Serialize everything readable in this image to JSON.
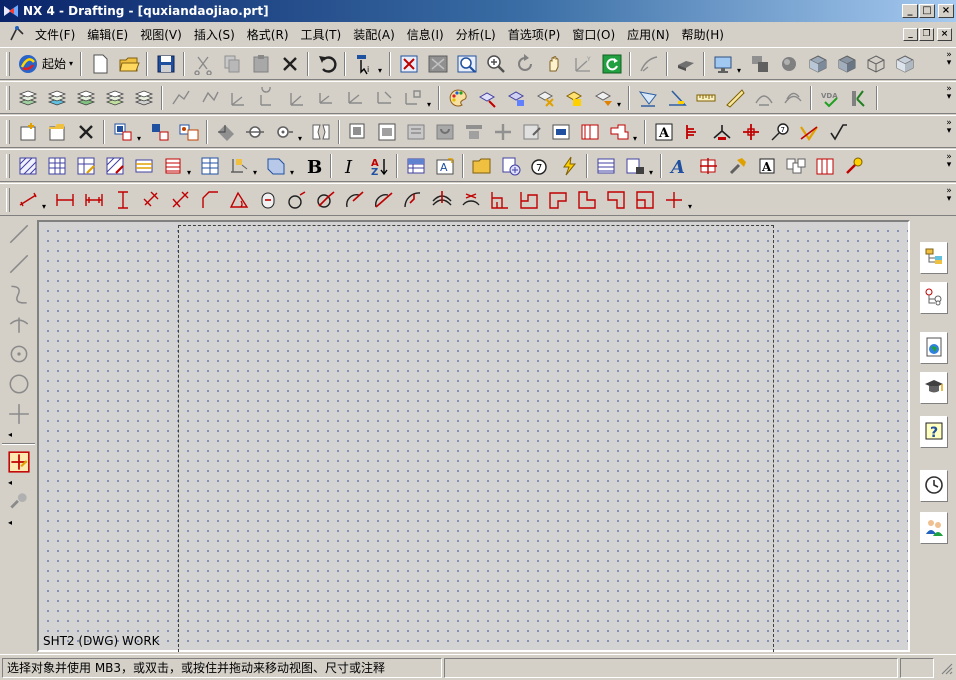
{
  "window": {
    "title": "NX 4 - Drafting - [quxiandaojiao.prt]",
    "minimize": "_",
    "maximize": "□",
    "close": "×"
  },
  "menu": {
    "items": [
      {
        "label": "文件(F)"
      },
      {
        "label": "编辑(E)"
      },
      {
        "label": "视图(V)"
      },
      {
        "label": "插入(S)"
      },
      {
        "label": "格式(R)"
      },
      {
        "label": "工具(T)"
      },
      {
        "label": "装配(A)"
      },
      {
        "label": "信息(I)"
      },
      {
        "label": "分析(L)"
      },
      {
        "label": "首选项(P)"
      },
      {
        "label": "窗口(O)"
      },
      {
        "label": "应用(N)"
      },
      {
        "label": "帮助(H)"
      }
    ],
    "mdi_minimize": "_",
    "mdi_restore": "❐",
    "mdi_close": "×"
  },
  "toolbar": {
    "start_label": "起始",
    "dropdown_glyph": "▾",
    "overflow_glyph": "»"
  },
  "canvas": {
    "view_label": "SHT2 (DWG) WORK"
  },
  "statusbar": {
    "message": "选择对象并使用 MB3，或双击，或按住并拖动来移动视图、尺寸或注释",
    "cell2": "",
    "cell3": ""
  },
  "colors": {
    "title_active": "#0a246a",
    "canvas_bg": "#d3d3d3",
    "grid_dot": "#6f7fb0",
    "chrome": "#d4d0c8"
  },
  "icons": {
    "row1": [
      "start-icon",
      "new-icon",
      "open-icon",
      "save-icon",
      "cut-icon",
      "copy-icon",
      "paste-icon",
      "delete-icon",
      "undo-icon",
      "select-icon",
      "fit-icon",
      "zoom-window-icon",
      "zoom-area-icon",
      "zoom-icon",
      "rotate-icon",
      "pan-icon",
      "wcs-icon",
      "refresh-icon",
      "sweep-icon",
      "view-shaded-icon",
      "display-icon",
      "layout-icon",
      "sphere-icon",
      "cube-shaded-icon",
      "cube-flat-icon",
      "cube-wire-icon",
      "cube-hidden-icon"
    ],
    "row2": [
      "layer-icon",
      "layer-settings-icon",
      "layer-move-icon",
      "layer-copy-icon",
      "layer-visible-icon",
      "spline-icon",
      "point-set-icon",
      "datum-axis-icon",
      "datum-plane-icon",
      "wcs-origin-icon",
      "wcs-point-icon",
      "wcs-xc-icon",
      "wcs-yc-icon",
      "wcs-orient-icon",
      "palette-icon",
      "edit-object-icon",
      "edit-display-icon",
      "hide-icon",
      "show-icon",
      "show-hide-icon",
      "measure-distance-icon",
      "measure-angle-icon",
      "measure-length-icon",
      "ruler-icon",
      "curve-analysis-icon",
      "deviation-icon",
      "vda-check-icon",
      "check-geometry-icon"
    ],
    "row3": [
      "sheet-new-icon",
      "sheet-open-icon",
      "sheet-delete-icon",
      "view-base-icon",
      "view-projected-icon",
      "view-detail-icon",
      "view-section-icon",
      "view-half-section-icon",
      "view-revolved-icon",
      "view-broken-icon",
      "view-update-icon",
      "view-display-icon",
      "view-boundary-icon",
      "view-hide-icon",
      "view-align-icon",
      "view-move-icon",
      "view-edit-icon",
      "view-style-icon",
      "view-break-icon",
      "view-aux-icon",
      "view-labels-icon",
      "note-icon",
      "datum-feature-icon",
      "weld-symbol-icon",
      "centerline-icon",
      "id-symbol-icon",
      "surface-finish-icon"
    ],
    "row4": [
      "hatch-icon",
      "table-icon",
      "table-edit-icon",
      "hatch-edit-icon",
      "parts-list-icon",
      "section-line-icon",
      "title-block-icon",
      "annotation-icon",
      "plane-icon",
      "bold-icon",
      "italic-icon",
      "sort-icon",
      "tabular-note-icon",
      "text-style-icon",
      "folder-icon",
      "attribute-icon",
      "balloon-icon",
      "lightning-icon",
      "drawing-list-icon",
      "drawing-export-icon",
      "font-a-icon",
      "image-icon",
      "tools-icon",
      "utility-symbol-icon",
      "pattern-icon",
      "grid-icon",
      "custom-symbol-icon"
    ],
    "row5": [
      "dim-inferred-icon",
      "dim-horizontal-icon",
      "dim-horizontal-chain-icon",
      "dim-vertical-icon",
      "dim-parallel-icon",
      "dim-perpendicular-icon",
      "dim-chamfer-icon",
      "dim-angular-icon",
      "dim-cylindrical-icon",
      "dim-hole-icon",
      "dim-diameter-icon",
      "dim-radius-icon",
      "dim-radius-center-icon",
      "dim-folded-radius-icon",
      "dim-thickness-icon",
      "dim-arc-length-icon",
      "dim-ordinate-icon",
      "dim-chain-icon",
      "dim-baseline-icon",
      "dim-horizontal-baseline-icon",
      "dim-vertical-chain-icon",
      "dim-vertical-baseline-icon",
      "dim-origin-icon"
    ],
    "left": [
      "line-icon",
      "line-2-icon",
      "spline-curve-icon",
      "perpendicular-icon",
      "circle-center-icon",
      "circle-icon",
      "crosshair-icon",
      "snap-point-icon",
      "snap-settings-icon"
    ],
    "right": [
      "assembly-navigator-icon",
      "part-navigator-icon",
      "browser-icon",
      "training-icon",
      "help-icon",
      "history-icon",
      "roles-icon"
    ]
  }
}
